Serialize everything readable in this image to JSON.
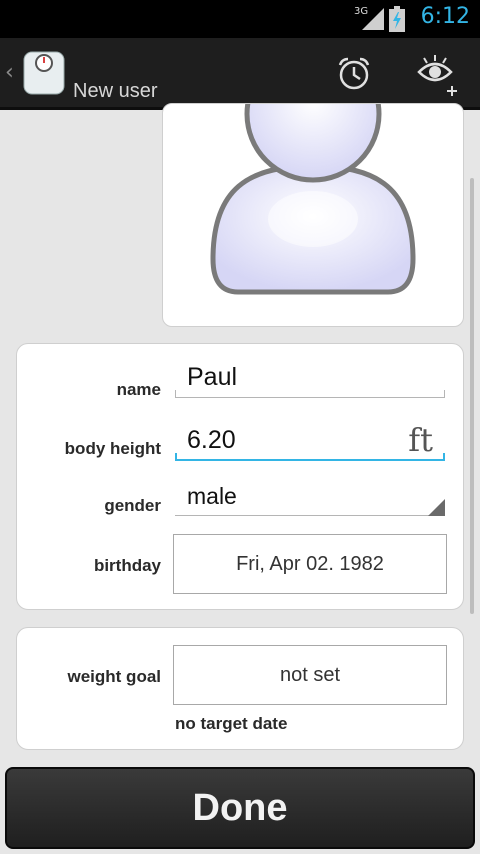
{
  "status_bar": {
    "network": "3G",
    "time": "6:12"
  },
  "action_bar": {
    "title": "New user",
    "icons": [
      "back-chevron-icon",
      "scale-logo-icon",
      "alarm-clock-icon",
      "eye-plus-icon"
    ]
  },
  "profile": {
    "fields": {
      "name": {
        "label": "name",
        "value": "Paul"
      },
      "body_height": {
        "label": "body height",
        "value": "6.20",
        "unit": "ft"
      },
      "gender": {
        "label": "gender",
        "value": "male"
      },
      "birthday": {
        "label": "birthday",
        "value": "Fri, Apr 02. 1982"
      }
    }
  },
  "goal": {
    "label": "weight goal",
    "value": "not set",
    "target_date": "no target date"
  },
  "done_label": "Done",
  "colors": {
    "accent": "#33b5e5",
    "action_bar": "#1e1e1e",
    "background": "#e6e6e6"
  }
}
